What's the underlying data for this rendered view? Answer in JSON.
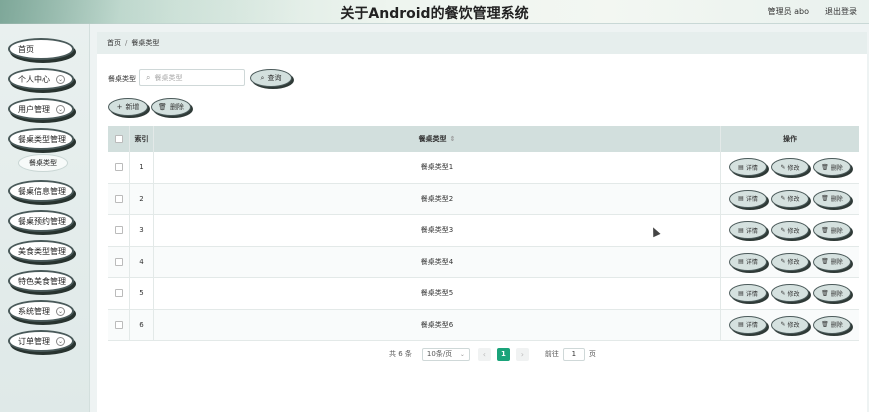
{
  "header": {
    "title": "关于Android的餐饮管理系统",
    "user": "管理员 abo",
    "logout": "退出登录"
  },
  "sidebar": {
    "items": [
      {
        "label": "首页",
        "has_chevron": false
      },
      {
        "label": "个人中心",
        "has_chevron": true
      },
      {
        "label": "用户管理",
        "has_chevron": true
      },
      {
        "label": "餐桌类型管理",
        "has_chevron": false
      },
      {
        "label": "餐桌信息管理",
        "has_chevron": false
      },
      {
        "label": "餐桌预约管理",
        "has_chevron": false
      },
      {
        "label": "美食类型管理",
        "has_chevron": false
      },
      {
        "label": "特色美食管理",
        "has_chevron": false
      },
      {
        "label": "系统管理",
        "has_chevron": true
      },
      {
        "label": "订单管理",
        "has_chevron": true
      }
    ],
    "sub_item": "餐桌类型"
  },
  "breadcrumb": {
    "home": "首页",
    "sep": "/",
    "current": "餐桌类型"
  },
  "search": {
    "label": "餐桌类型",
    "placeholder": "餐桌类型",
    "button": "查询"
  },
  "actions": {
    "add": "新增",
    "delete": "删除"
  },
  "table": {
    "headers": {
      "index": "索引",
      "name": "餐桌类型",
      "ops": "操作"
    },
    "rows": [
      {
        "index": "1",
        "name": "餐桌类型1"
      },
      {
        "index": "2",
        "name": "餐桌类型2"
      },
      {
        "index": "3",
        "name": "餐桌类型3"
      },
      {
        "index": "4",
        "name": "餐桌类型4"
      },
      {
        "index": "5",
        "name": "餐桌类型5"
      },
      {
        "index": "6",
        "name": "餐桌类型6"
      }
    ],
    "row_ops": {
      "detail": "详情",
      "edit": "修改",
      "delete": "删除"
    }
  },
  "pagination": {
    "total": "共 6 条",
    "page_size": "10条/页",
    "current": "1",
    "goto_label": "前往",
    "goto_value": "1",
    "page_unit": "页"
  },
  "icons": {
    "search": "search-icon",
    "add": "plus-icon",
    "delete": "trash-icon",
    "detail": "file-icon",
    "edit": "pencil-icon"
  }
}
